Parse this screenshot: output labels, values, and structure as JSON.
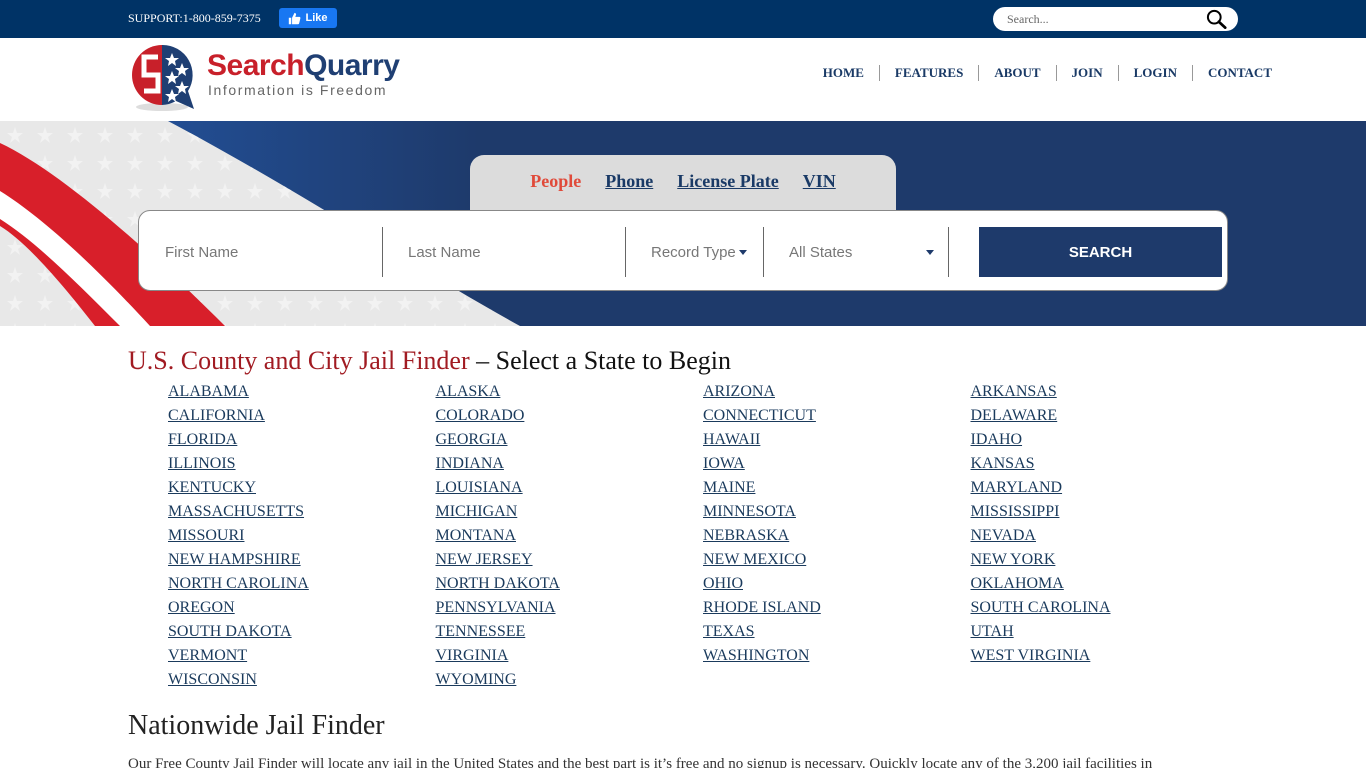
{
  "topbar": {
    "support": "SUPPORT:1-800-859-7375",
    "fb_like": "Like",
    "search_placeholder": "Search..."
  },
  "brand": {
    "name_part1": "Search",
    "name_part2": "Quarry",
    "tagline": "Information is Freedom",
    "colors": {
      "red": "#c8202a",
      "navy": "#1f3f73"
    }
  },
  "nav": [
    "HOME",
    "FEATURES",
    "ABOUT",
    "JOIN",
    "LOGIN",
    "CONTACT"
  ],
  "hero": {
    "tabs": [
      {
        "label": "People",
        "active": true
      },
      {
        "label": "Phone",
        "active": false
      },
      {
        "label": "License Plate",
        "active": false
      },
      {
        "label": "VIN",
        "active": false
      }
    ],
    "first_name_placeholder": "First Name",
    "last_name_placeholder": "Last Name",
    "record_type": "Record Type",
    "state_select": "All States",
    "search_button": "SEARCH"
  },
  "main": {
    "title_red": "U.S. County and City Jail Finder",
    "title_rest": " – Select a State to Begin",
    "states": [
      "ALABAMA",
      "ALASKA",
      "ARIZONA",
      "ARKANSAS",
      "CALIFORNIA",
      "COLORADO",
      "CONNECTICUT",
      "DELAWARE",
      "FLORIDA",
      "GEORGIA",
      "HAWAII",
      "IDAHO",
      "ILLINOIS",
      "INDIANA",
      "IOWA",
      "KANSAS",
      "KENTUCKY",
      "LOUISIANA",
      "MAINE",
      "MARYLAND",
      "MASSACHUSETTS",
      "MICHIGAN",
      "MINNESOTA",
      "MISSISSIPPI",
      "MISSOURI",
      "MONTANA",
      "NEBRASKA",
      "NEVADA",
      "NEW HAMPSHIRE",
      "NEW JERSEY",
      "NEW MEXICO",
      "NEW YORK",
      "NORTH CAROLINA",
      "NORTH DAKOTA",
      "OHIO",
      "OKLAHOMA",
      "OREGON",
      "PENNSYLVANIA",
      "RHODE ISLAND",
      "SOUTH CAROLINA",
      "SOUTH DAKOTA",
      "TENNESSEE",
      "TEXAS",
      "UTAH",
      "VERMONT",
      "VIRGINIA",
      "WASHINGTON",
      "WEST VIRGINIA",
      "WISCONSIN",
      "WYOMING"
    ],
    "subheading": "Nationwide Jail Finder",
    "paragraph": "Our Free County Jail Finder will locate any jail in the United States and the best part is it’s free and no signup is necessary. Quickly locate any of the 3,200 jail facilities in"
  }
}
